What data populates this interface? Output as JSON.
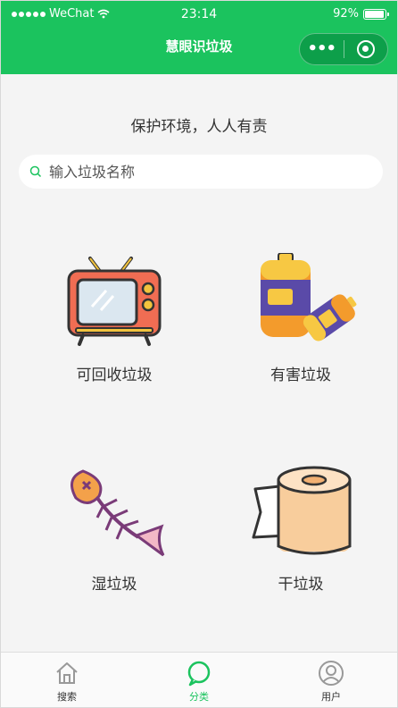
{
  "status_bar": {
    "carrier": "WeChat",
    "time": "23:14",
    "battery": "92%",
    "battery_level": 0.92
  },
  "nav": {
    "title": "慧眼识垃圾",
    "more_icon": "more-dots-icon",
    "close_icon": "mini-program-close-icon"
  },
  "main": {
    "slogan": "保护环境，人人有责",
    "search": {
      "placeholder": "输入垃圾名称",
      "value": ""
    }
  },
  "categories": [
    {
      "label": "可回收垃圾",
      "icon": "tv-icon"
    },
    {
      "label": "有害垃圾",
      "icon": "battery-icon"
    },
    {
      "label": "湿垃圾",
      "icon": "fish-bone-icon"
    },
    {
      "label": "干垃圾",
      "icon": "toilet-paper-icon"
    }
  ],
  "tabbar": {
    "items": [
      {
        "label": "搜索",
        "icon": "home-icon",
        "active": false
      },
      {
        "label": "分类",
        "icon": "chat-bubble-icon",
        "active": true
      },
      {
        "label": "用户",
        "icon": "user-icon",
        "active": false
      }
    ]
  },
  "colors": {
    "brand": "#1bc35e",
    "active_tab": "#1bc35e"
  }
}
